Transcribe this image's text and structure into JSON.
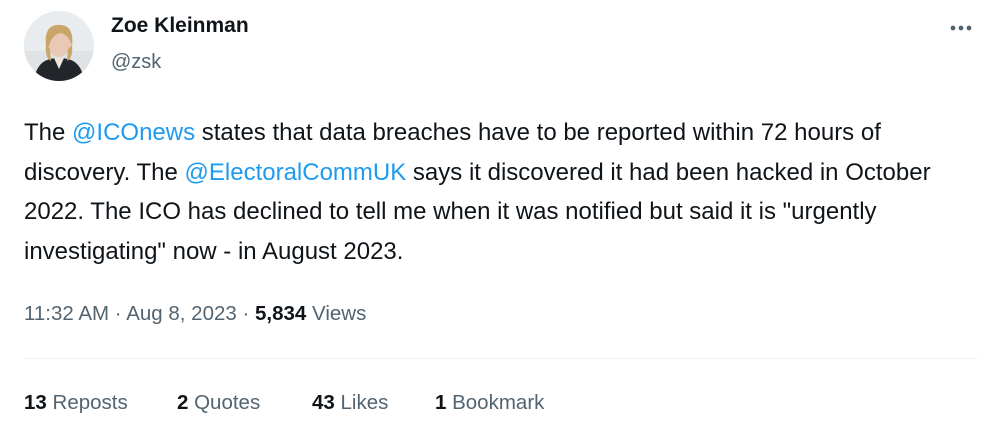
{
  "author": {
    "name": "Zoe Kleinman",
    "handle": "@zsk",
    "avatar_icon": "profile-photo"
  },
  "more_icon": "more-horizontal-icon",
  "tweet": {
    "segments": [
      {
        "text": "The ",
        "type": "text"
      },
      {
        "text": "@ICOnews",
        "type": "mention"
      },
      {
        "text": " states that data breaches have to be reported within 72 hours of discovery. The ",
        "type": "text"
      },
      {
        "text": "@ElectoralCommUK",
        "type": "mention"
      },
      {
        "text": " says it discovered it had been hacked in October 2022. The ICO has declined to tell me when it was notified but said it is \"urgently investigating\" now - in August 2023.",
        "type": "text"
      }
    ]
  },
  "meta": {
    "time": "11:32 AM",
    "separator": "·",
    "date": "Aug 8, 2023",
    "views_count": "5,834",
    "views_label": "Views"
  },
  "stats": {
    "reposts_count": "13",
    "reposts_label": "Reposts",
    "quotes_count": "2",
    "quotes_label": "Quotes",
    "likes_count": "43",
    "likes_label": "Likes",
    "bookmarks_count": "1",
    "bookmarks_label": "Bookmark"
  },
  "colors": {
    "text": "#0f1419",
    "secondary": "#536471",
    "link": "#1d9bf0",
    "divider": "#eff3f4"
  }
}
